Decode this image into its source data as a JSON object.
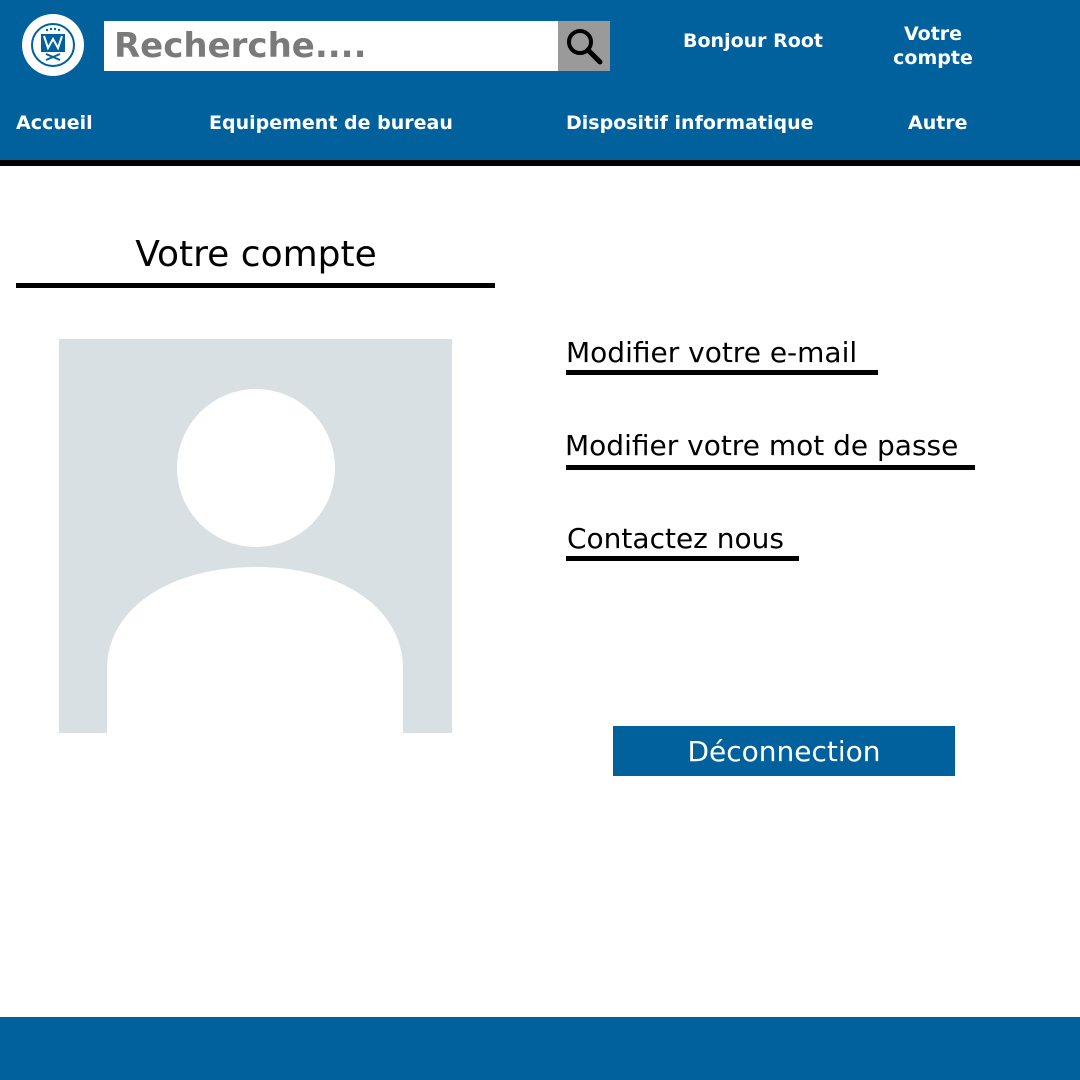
{
  "header": {
    "search": {
      "placeholder": "Recherche...."
    },
    "greeting": "Bonjour Root",
    "account_link": "Votre compte"
  },
  "nav": {
    "items": [
      {
        "label": "Accueil"
      },
      {
        "label": "Equipement de bureau"
      },
      {
        "label": "Dispositif informatique"
      },
      {
        "label": "Autre"
      }
    ]
  },
  "main": {
    "title": "Votre compte",
    "actions": [
      {
        "label": "Modifier votre e-mail"
      },
      {
        "label": "Modifier votre mot de passe"
      },
      {
        "label": "Contactez nous"
      }
    ],
    "logout_label": "Déconnection"
  },
  "icons": {
    "logo": "emblem-logo-icon",
    "search": "search-icon",
    "avatar": "user-placeholder-icon"
  },
  "colors": {
    "brand_blue": "#00619d",
    "search_button": "#9a9a9a",
    "avatar_background": "#d9e0e4",
    "avatar_figure": "#ffffff",
    "rule": "#000000"
  }
}
